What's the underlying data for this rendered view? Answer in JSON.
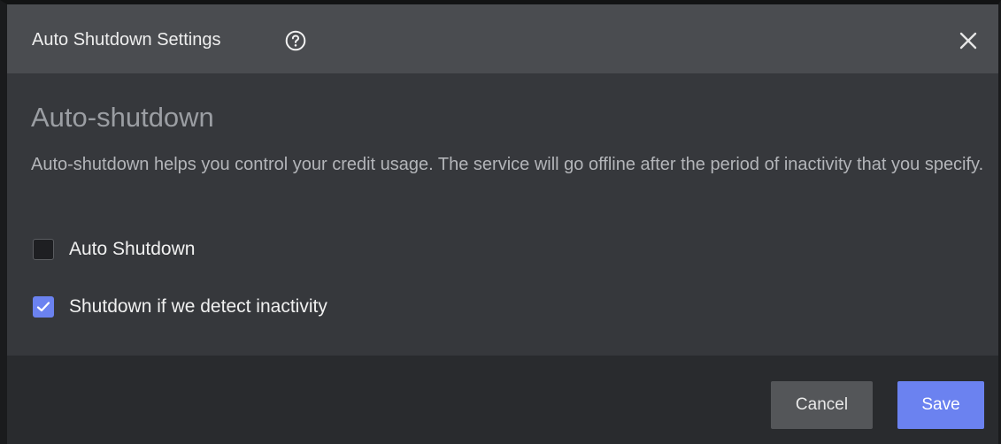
{
  "dialog": {
    "title": "Auto Shutdown Settings",
    "help_icon": "question-circle-icon",
    "close_icon": "close-icon"
  },
  "content": {
    "heading": "Auto-shutdown",
    "description": "Auto-shutdown helps you control your credit usage. The service will go offline after the period of inactivity that you specify.",
    "options": [
      {
        "label": "Auto Shutdown",
        "checked": false
      },
      {
        "label": "Shutdown if we detect inactivity",
        "checked": true
      }
    ]
  },
  "footer": {
    "cancel_label": "Cancel",
    "save_label": "Save"
  },
  "colors": {
    "accent": "#6b82f0",
    "header_bg": "#4a4c50",
    "body_bg": "#36383c",
    "footer_bg": "#292b2e"
  }
}
